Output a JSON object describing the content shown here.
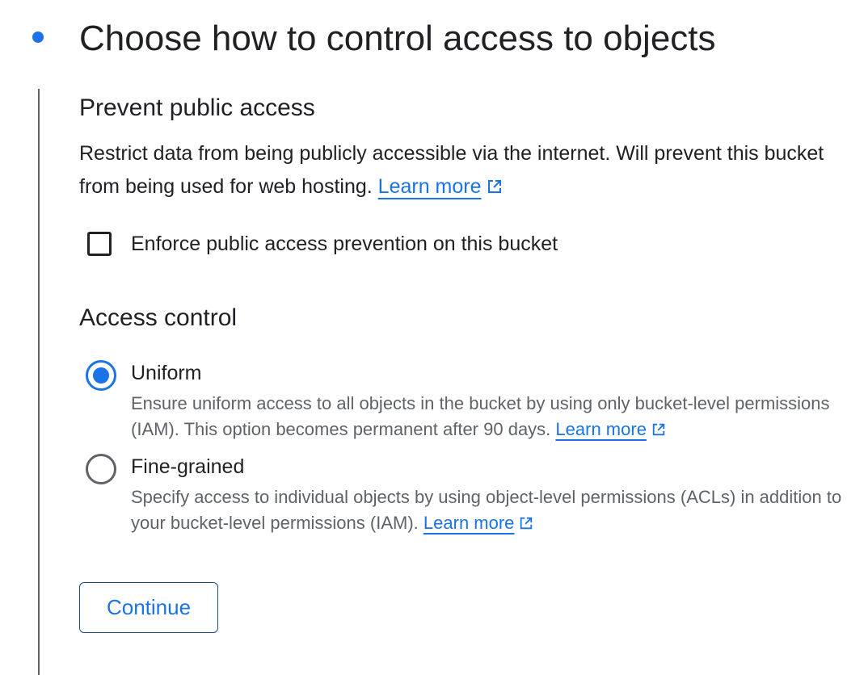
{
  "step": {
    "title": "Choose how to control access to objects"
  },
  "prevent_public_access": {
    "heading": "Prevent public access",
    "description": "Restrict data from being publicly accessible via the internet. Will prevent this bucket from being used for web hosting.",
    "learn_more": "Learn more",
    "checkbox_label": "Enforce public access prevention on this bucket",
    "checkbox_checked": false
  },
  "access_control": {
    "heading": "Access control",
    "options": [
      {
        "label": "Uniform",
        "description": "Ensure uniform access to all objects in the bucket by using only bucket-level permissions (IAM). This option becomes permanent after 90 days.",
        "learn_more": "Learn more",
        "selected": true
      },
      {
        "label": "Fine-grained",
        "description": "Specify access to individual objects by using object-level permissions (ACLs) in addition to your bucket-level permissions (IAM).",
        "learn_more": "Learn more",
        "selected": false
      }
    ]
  },
  "actions": {
    "continue_label": "Continue"
  },
  "colors": {
    "accent": "#1a73e8",
    "text": "#202124",
    "secondary_text": "#5f6368"
  }
}
